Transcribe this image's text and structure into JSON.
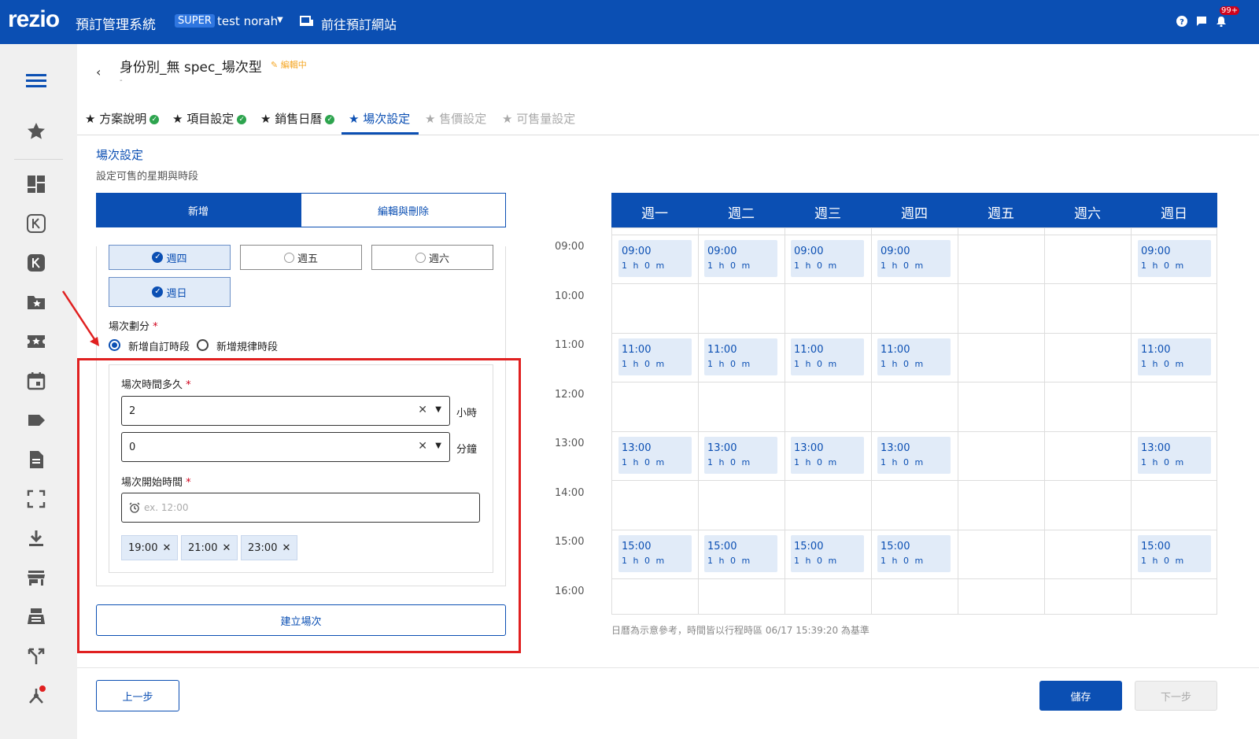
{
  "header": {
    "logo": "rezio",
    "system_name": "預訂管理系統",
    "role_badge": "SUPER",
    "user_name": "test norah",
    "goto_link": "前往預訂網站",
    "notif_count": "99+"
  },
  "page": {
    "title": "身份別_無 spec_場次型",
    "edit_status": "編輯中",
    "subtitle": "-"
  },
  "tabs": [
    {
      "label": "★ 方案說明"
    },
    {
      "label": "★ 項目設定"
    },
    {
      "label": "★ 銷售日曆"
    },
    {
      "label": "★ 場次設定"
    },
    {
      "label": "★ 售價設定"
    },
    {
      "label": "★ 可售量設定"
    }
  ],
  "section": {
    "title": "場次設定",
    "subtitle": "設定可售的星期與時段"
  },
  "segment": {
    "add": "新增",
    "edit": "編輯與刪除"
  },
  "days": [
    {
      "label": "週四",
      "checked": true
    },
    {
      "label": "週五",
      "checked": false
    },
    {
      "label": "週六",
      "checked": false
    },
    {
      "label": "週日",
      "checked": true
    }
  ],
  "form": {
    "split_label": "場次劃分",
    "radio_custom": "新增自訂時段",
    "radio_regular": "新增規律時段",
    "duration_label": "場次時間多久",
    "hours_value": "2",
    "hours_unit": "小時",
    "minutes_value": "0",
    "minutes_unit": "分鐘",
    "start_label": "場次開始時間",
    "start_placeholder": "ex. 12:00",
    "chips": [
      "19:00",
      "21:00",
      "23:00"
    ],
    "create_button": "建立場次"
  },
  "calendar": {
    "days": [
      "週一",
      "週二",
      "週三",
      "週四",
      "週五",
      "週六",
      "週日"
    ],
    "hours": [
      "09:00",
      "10:00",
      "11:00",
      "12:00",
      "13:00",
      "14:00",
      "15:00",
      "16:00"
    ],
    "slot_duration": "1 h 0 m",
    "slot_times": [
      "09:00",
      "11:00",
      "13:00",
      "15:00"
    ],
    "slot_days": [
      "週一",
      "週二",
      "週三",
      "週四",
      "週日"
    ],
    "note": "日曆為示意參考，時間皆以行程時區 06/17 15:39:20 為基準"
  },
  "footer": {
    "prev": "上一步",
    "save": "儲存",
    "next": "下一步"
  },
  "colors": {
    "primary": "#0b4fb3",
    "slot_bg": "#e1ebf8",
    "annotation": "#e02020",
    "success": "#2da44e"
  }
}
